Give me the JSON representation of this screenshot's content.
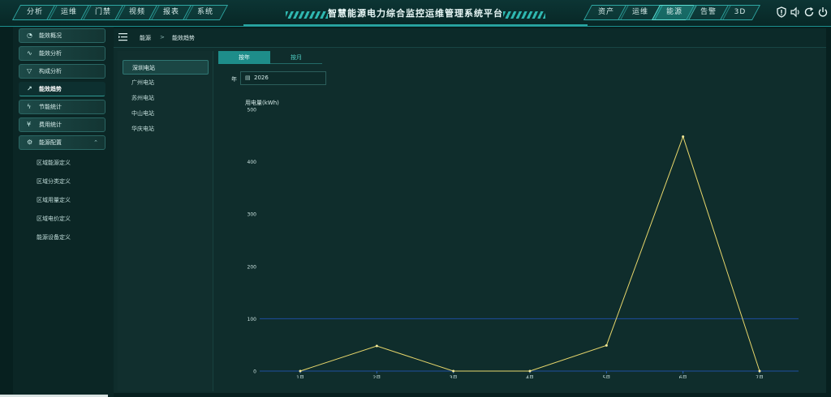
{
  "header": {
    "title": "智慧能源电力综合监控运维管理系统平台",
    "left_tabs": [
      "分析",
      "运维",
      "门禁",
      "视频",
      "报表",
      "系统"
    ],
    "right_tabs": [
      "资产",
      "运维",
      "能源",
      "告警",
      "3D"
    ],
    "active_right_tab": 2,
    "icons": [
      "alert-icon",
      "volume-icon",
      "refresh-icon",
      "power-icon"
    ]
  },
  "sidebar": {
    "items": [
      {
        "label": "能效概况",
        "icon": "gauge-icon"
      },
      {
        "label": "能效分析",
        "icon": "pulse-icon"
      },
      {
        "label": "构成分析",
        "icon": "filter-icon"
      },
      {
        "label": "能效趋势",
        "icon": "trend-icon"
      },
      {
        "label": "节能统计",
        "icon": "bolt-icon"
      },
      {
        "label": "费用统计",
        "icon": "yen-icon"
      },
      {
        "label": "能源配置",
        "icon": "config-icon"
      }
    ],
    "active_item": 3,
    "sub_items": [
      "区域能源定义",
      "区域分类定义",
      "区域用量定义",
      "区域电价定义",
      "能源设备定义"
    ]
  },
  "breadcrumb": {
    "root": "能源",
    "separator": ">",
    "current": "能效趋势"
  },
  "stations": [
    "深圳电站",
    "广州电站",
    "苏州电站",
    "中山电站",
    "华庆电站"
  ],
  "active_station": 0,
  "tabs": {
    "primary": "按年",
    "secondary": "按月"
  },
  "date_filter": {
    "label": "年",
    "value": "2026"
  },
  "chart_data": {
    "type": "line",
    "ylabel": "用电量(kWh)",
    "categories": [
      "1月",
      "2月",
      "3月",
      "4月",
      "5月",
      "6月",
      "7月"
    ],
    "values": [
      0,
      48,
      0,
      0,
      49,
      448,
      0
    ],
    "ylim": [
      0,
      500
    ],
    "yticks": [
      0,
      100,
      200,
      300,
      400,
      500
    ],
    "line_color": "#e7d66b",
    "gridline_color": "#1f4fa0",
    "grid": false
  }
}
